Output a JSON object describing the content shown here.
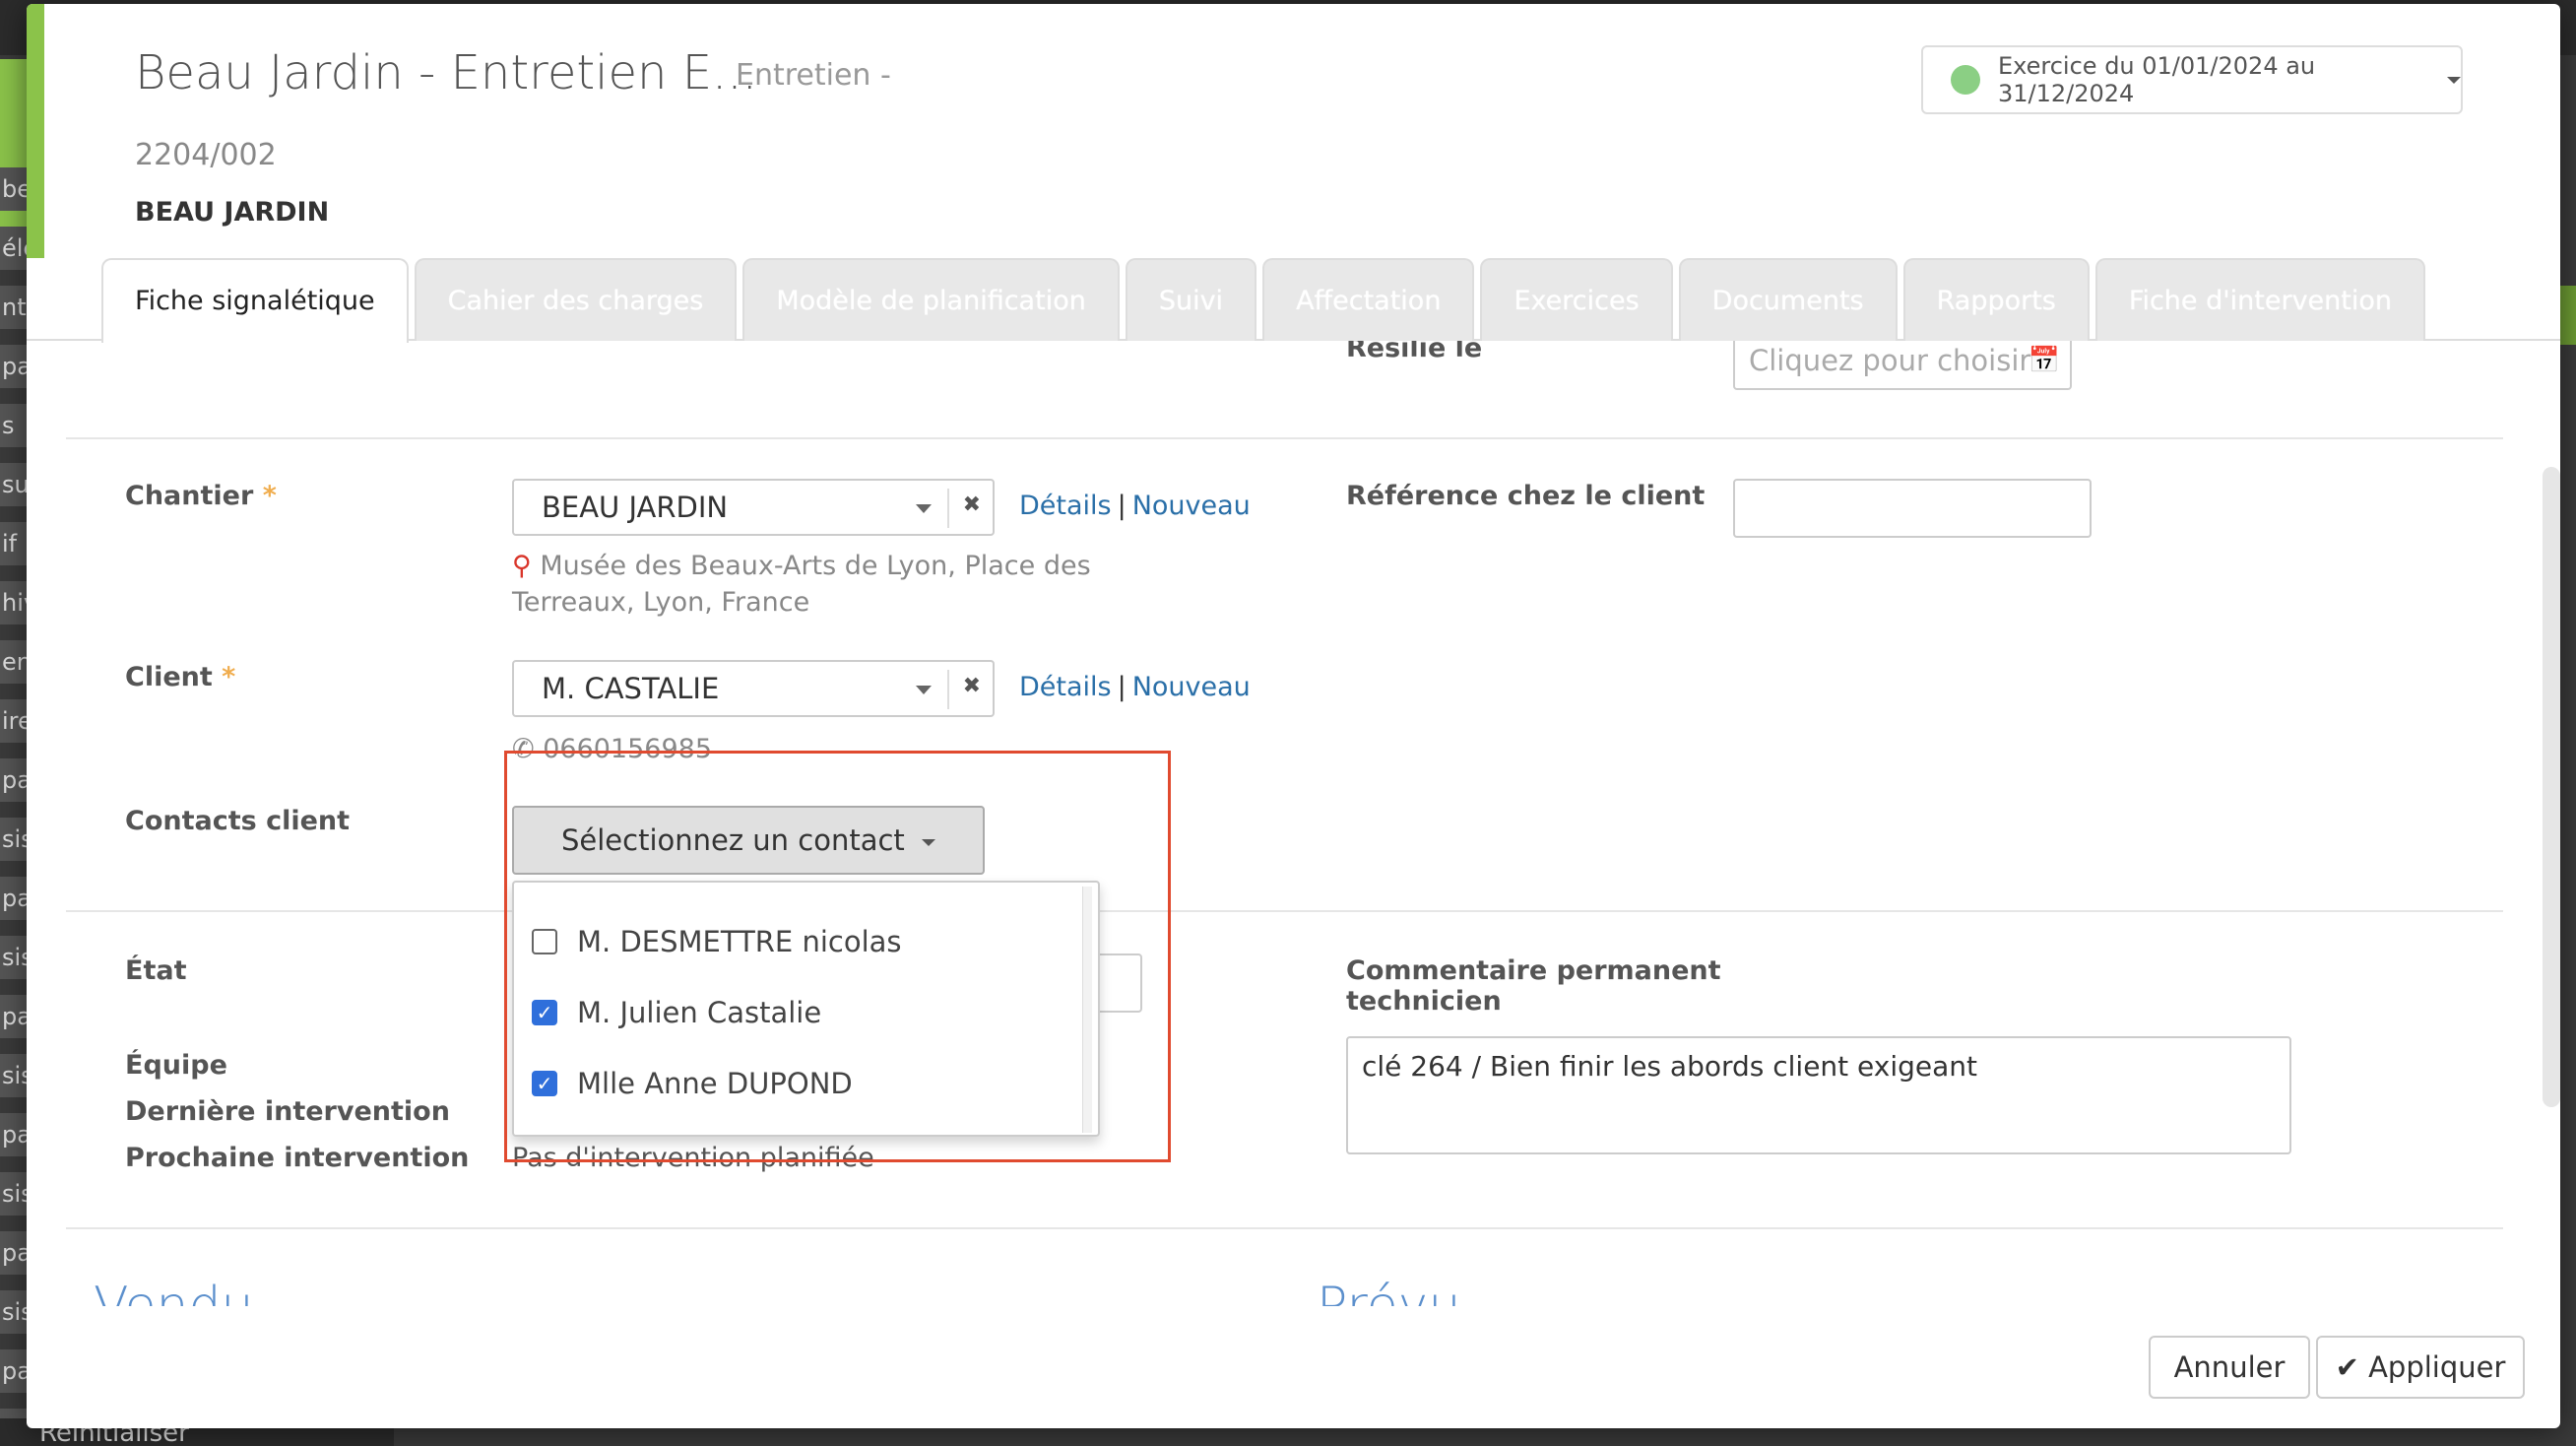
{
  "background": {
    "side_items": [
      "be",
      "éle",
      "nts",
      "pa",
      "s",
      "sui",
      "if",
      "hiv",
      "en",
      "ire",
      "pa",
      "sis",
      "pa",
      "sis",
      "pa",
      "sis",
      "pa",
      "sis",
      "pa",
      "sis",
      "pa",
      "sis"
    ],
    "bottom_text": "Réinitialiser"
  },
  "header": {
    "title": "Beau Jardin - Entretien E...",
    "subtype": "Entretien -",
    "reference": "2204/002",
    "client": "BEAU JARDIN",
    "exercise": "Exercice du 01/01/2024 au 31/12/2024"
  },
  "tabs": [
    {
      "label": "Fiche signalétique",
      "active": true
    },
    {
      "label": "Cahier des charges",
      "active": false
    },
    {
      "label": "Modèle de planification",
      "active": false
    },
    {
      "label": "Suivi",
      "active": false
    },
    {
      "label": "Affectation",
      "active": false
    },
    {
      "label": "Exercices",
      "active": false
    },
    {
      "label": "Documents",
      "active": false
    },
    {
      "label": "Rapports",
      "active": false
    },
    {
      "label": "Fiche d'intervention",
      "active": false
    }
  ],
  "form": {
    "resilie": {
      "label": "Résilié le",
      "placeholder": "Cliquez pour choisir u"
    },
    "chantier": {
      "label": "Chantier",
      "required": "*",
      "value": "BEAU JARDIN",
      "details": "Détails",
      "separator": "|",
      "nouveau": "Nouveau",
      "address": "Musée des Beaux-Arts de Lyon, Place des Terreaux, Lyon, France"
    },
    "reference_client": {
      "label": "Référence chez le client",
      "value": ""
    },
    "client": {
      "label": "Client",
      "required": "*",
      "value": "M. CASTALIE",
      "details": "Détails",
      "separator": "|",
      "nouveau": "Nouveau",
      "phone": "0660156985"
    },
    "contacts": {
      "label": "Contacts client",
      "button": "Sélectionnez un contact",
      "options": [
        {
          "label": "M. DESMETTRE nicolas",
          "checked": false
        },
        {
          "label": "M. Julien Castalie",
          "checked": true
        },
        {
          "label": "Mlle Anne DUPOND",
          "checked": true
        }
      ]
    },
    "etat": {
      "label": "État"
    },
    "equipe": {
      "label": "Équipe"
    },
    "derniere": {
      "label": "Dernière intervention"
    },
    "prochaine": {
      "label": "Prochaine intervention",
      "value": "Pas d'intervention planifiée"
    },
    "commentaire": {
      "label_line1": "Commentaire permanent",
      "label_line2": "technicien",
      "value": "clé 264 / Bien finir les abords client exigeant"
    },
    "sections": {
      "vendu": "Vendu",
      "prevu": "Prévu"
    }
  },
  "footer": {
    "cancel": "Annuler",
    "apply": "Appliquer"
  },
  "colors": {
    "accent_green": "#8bc34a",
    "link_blue": "#2a6fa8",
    "checkbox_blue": "#2f6fdb",
    "highlight_red": "#e04a2f"
  }
}
